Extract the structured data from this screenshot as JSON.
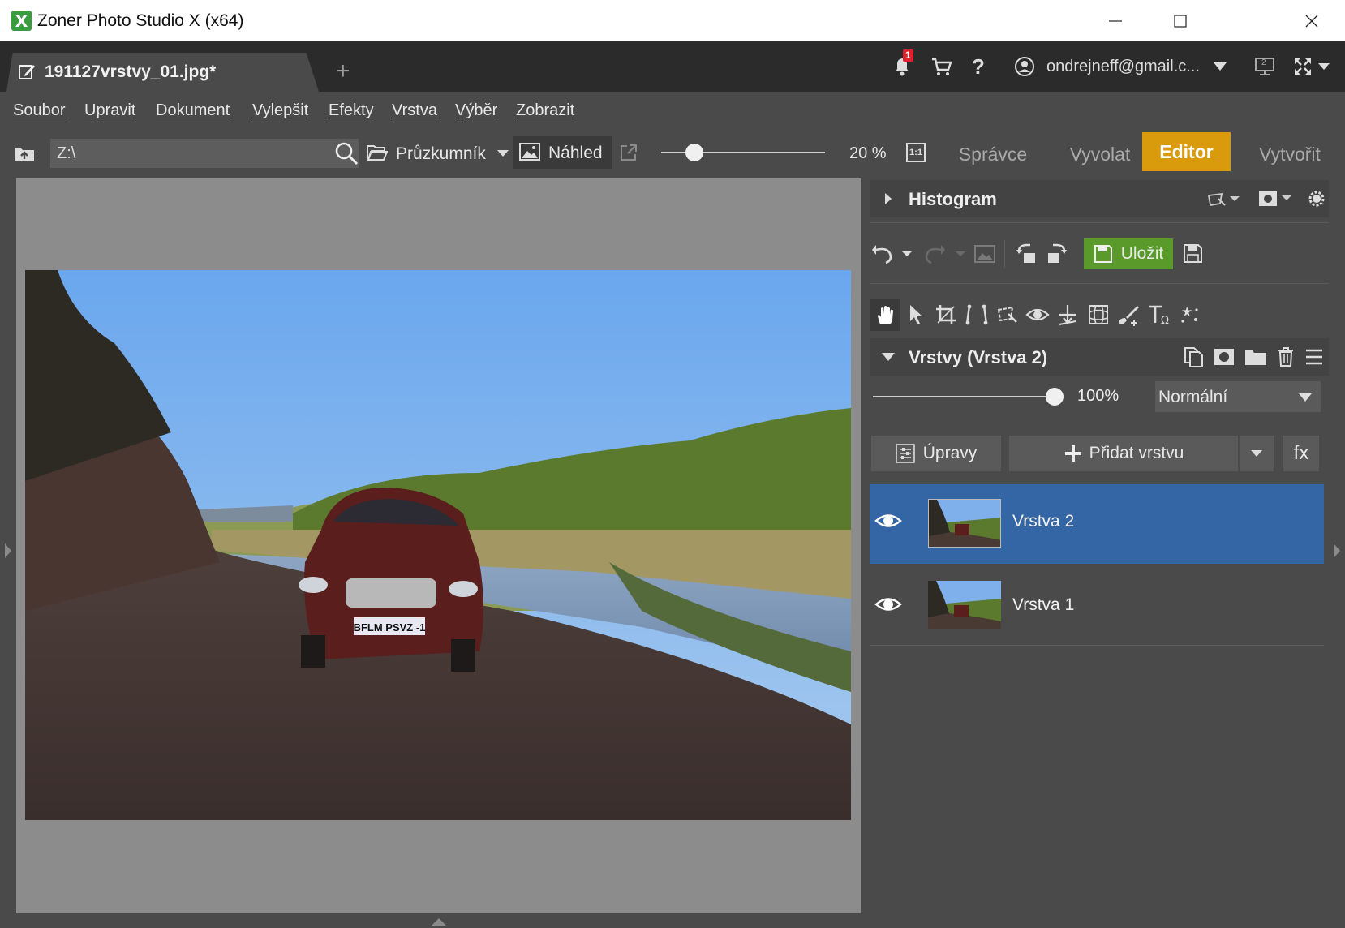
{
  "window": {
    "title": "Zoner Photo Studio X (x64)",
    "minimize_icon": "minimize-icon",
    "maximize_icon": "maximize-icon",
    "close_icon": "close-icon"
  },
  "tabs": {
    "active_tab": "191127vrstvy_01.jpg*",
    "add_tab": "+"
  },
  "topright": {
    "notification_badge": "1",
    "account": "ondrejneff@gmail.c...",
    "monitor_badge": "2"
  },
  "menu": [
    "Soubor",
    "Upravit",
    "Dokument",
    "Vylepšit",
    "Efekty",
    "Vrstva",
    "Výběr",
    "Zobrazit"
  ],
  "toolbar": {
    "path_value": "Z:\\",
    "explorer_label": "Průzkumník",
    "preview_label": "Náhled",
    "zoom_percent": "20 %",
    "zoom_level": 0.2,
    "one_to_one": "1:1"
  },
  "modes": [
    "Správce",
    "Vyvolat",
    "Editor",
    "Vytvořit"
  ],
  "active_mode": "Editor",
  "panel": {
    "histogram_title": "Histogram",
    "save_label": "Uložit",
    "layers_title": "Vrstvy (Vrstva 2)",
    "opacity_value": "100%",
    "opacity_fraction": 1.0,
    "blend_mode": "Normální",
    "adjust_label": "Úpravy",
    "add_layer_label": "Přidat vrstvu",
    "fx_label": "fx",
    "layers": [
      {
        "name": "Vrstva 2",
        "selected": true,
        "visible": true
      },
      {
        "name": "Vrstva 1",
        "selected": false,
        "visible": true
      }
    ]
  },
  "photo": {
    "plate_text": "BFLM PSVZ -1"
  },
  "colors": {
    "accent": "#d99a0b",
    "save_green": "#5a9a2a",
    "selection_blue": "#3465a4",
    "badge_red": "#e0202a"
  }
}
